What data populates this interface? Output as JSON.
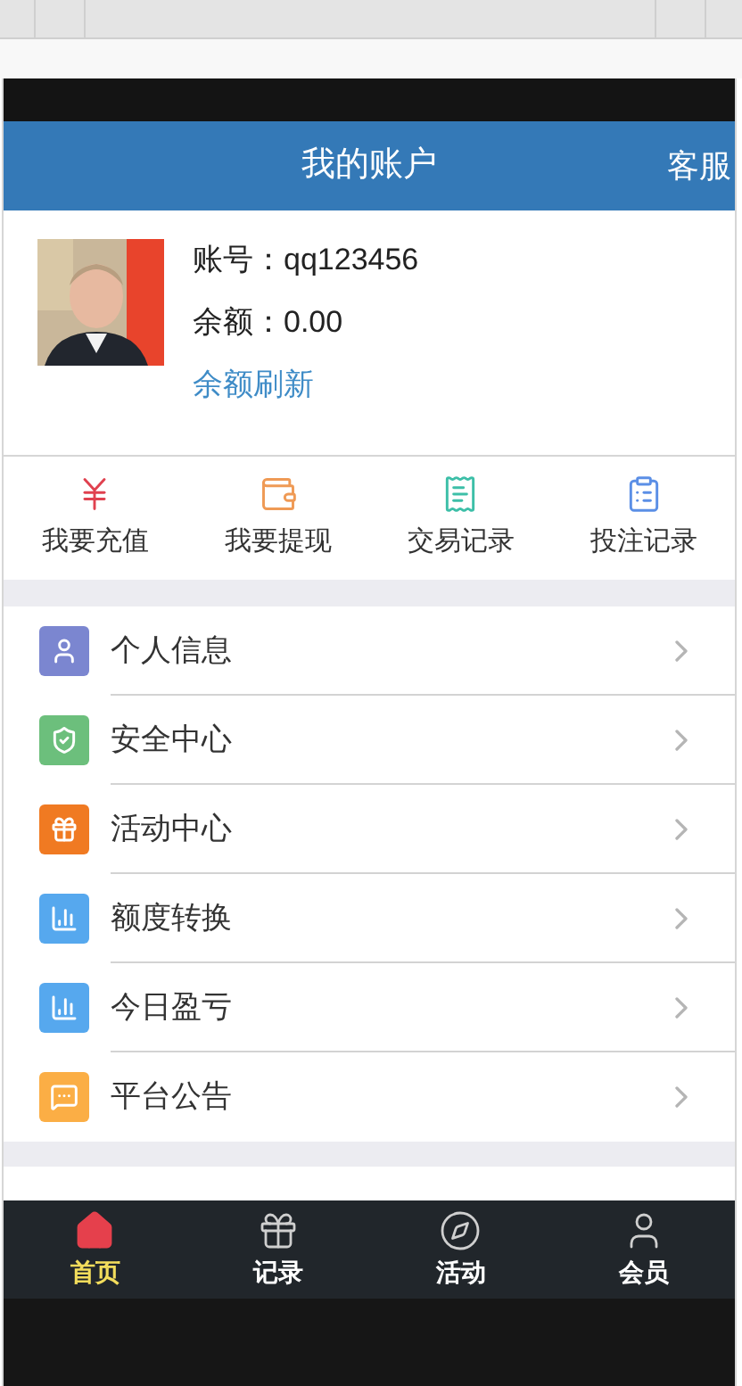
{
  "header": {
    "title": "我的账户",
    "action": "客服"
  },
  "profile": {
    "account": "账号：qq123456",
    "balance": "余额：0.00",
    "refresh": "余额刷新"
  },
  "actions": [
    {
      "kind": "recharge",
      "label": "我要充值"
    },
    {
      "kind": "withdraw",
      "label": "我要提现"
    },
    {
      "kind": "transactions",
      "label": "交易记录"
    },
    {
      "kind": "bets",
      "label": "投注记录"
    }
  ],
  "menu": [
    {
      "kind": "user",
      "label": "个人信息",
      "color": "#7b86d0"
    },
    {
      "kind": "shield",
      "label": "安全中心",
      "color": "#6cbf7c"
    },
    {
      "kind": "gift",
      "label": "活动中心",
      "color": "#f07a22"
    },
    {
      "kind": "chart",
      "label": "额度转换",
      "color": "#56a8ee"
    },
    {
      "kind": "chart",
      "label": "今日盈亏",
      "color": "#56a8ee"
    },
    {
      "kind": "notice",
      "label": "平台公告",
      "color": "#fbae45"
    }
  ],
  "nav": [
    {
      "kind": "home",
      "label": "首页",
      "selected": true
    },
    {
      "kind": "gift",
      "label": "记录",
      "selected": false
    },
    {
      "kind": "compass",
      "label": "活动",
      "selected": false
    },
    {
      "kind": "user",
      "label": "会员",
      "selected": false
    }
  ]
}
